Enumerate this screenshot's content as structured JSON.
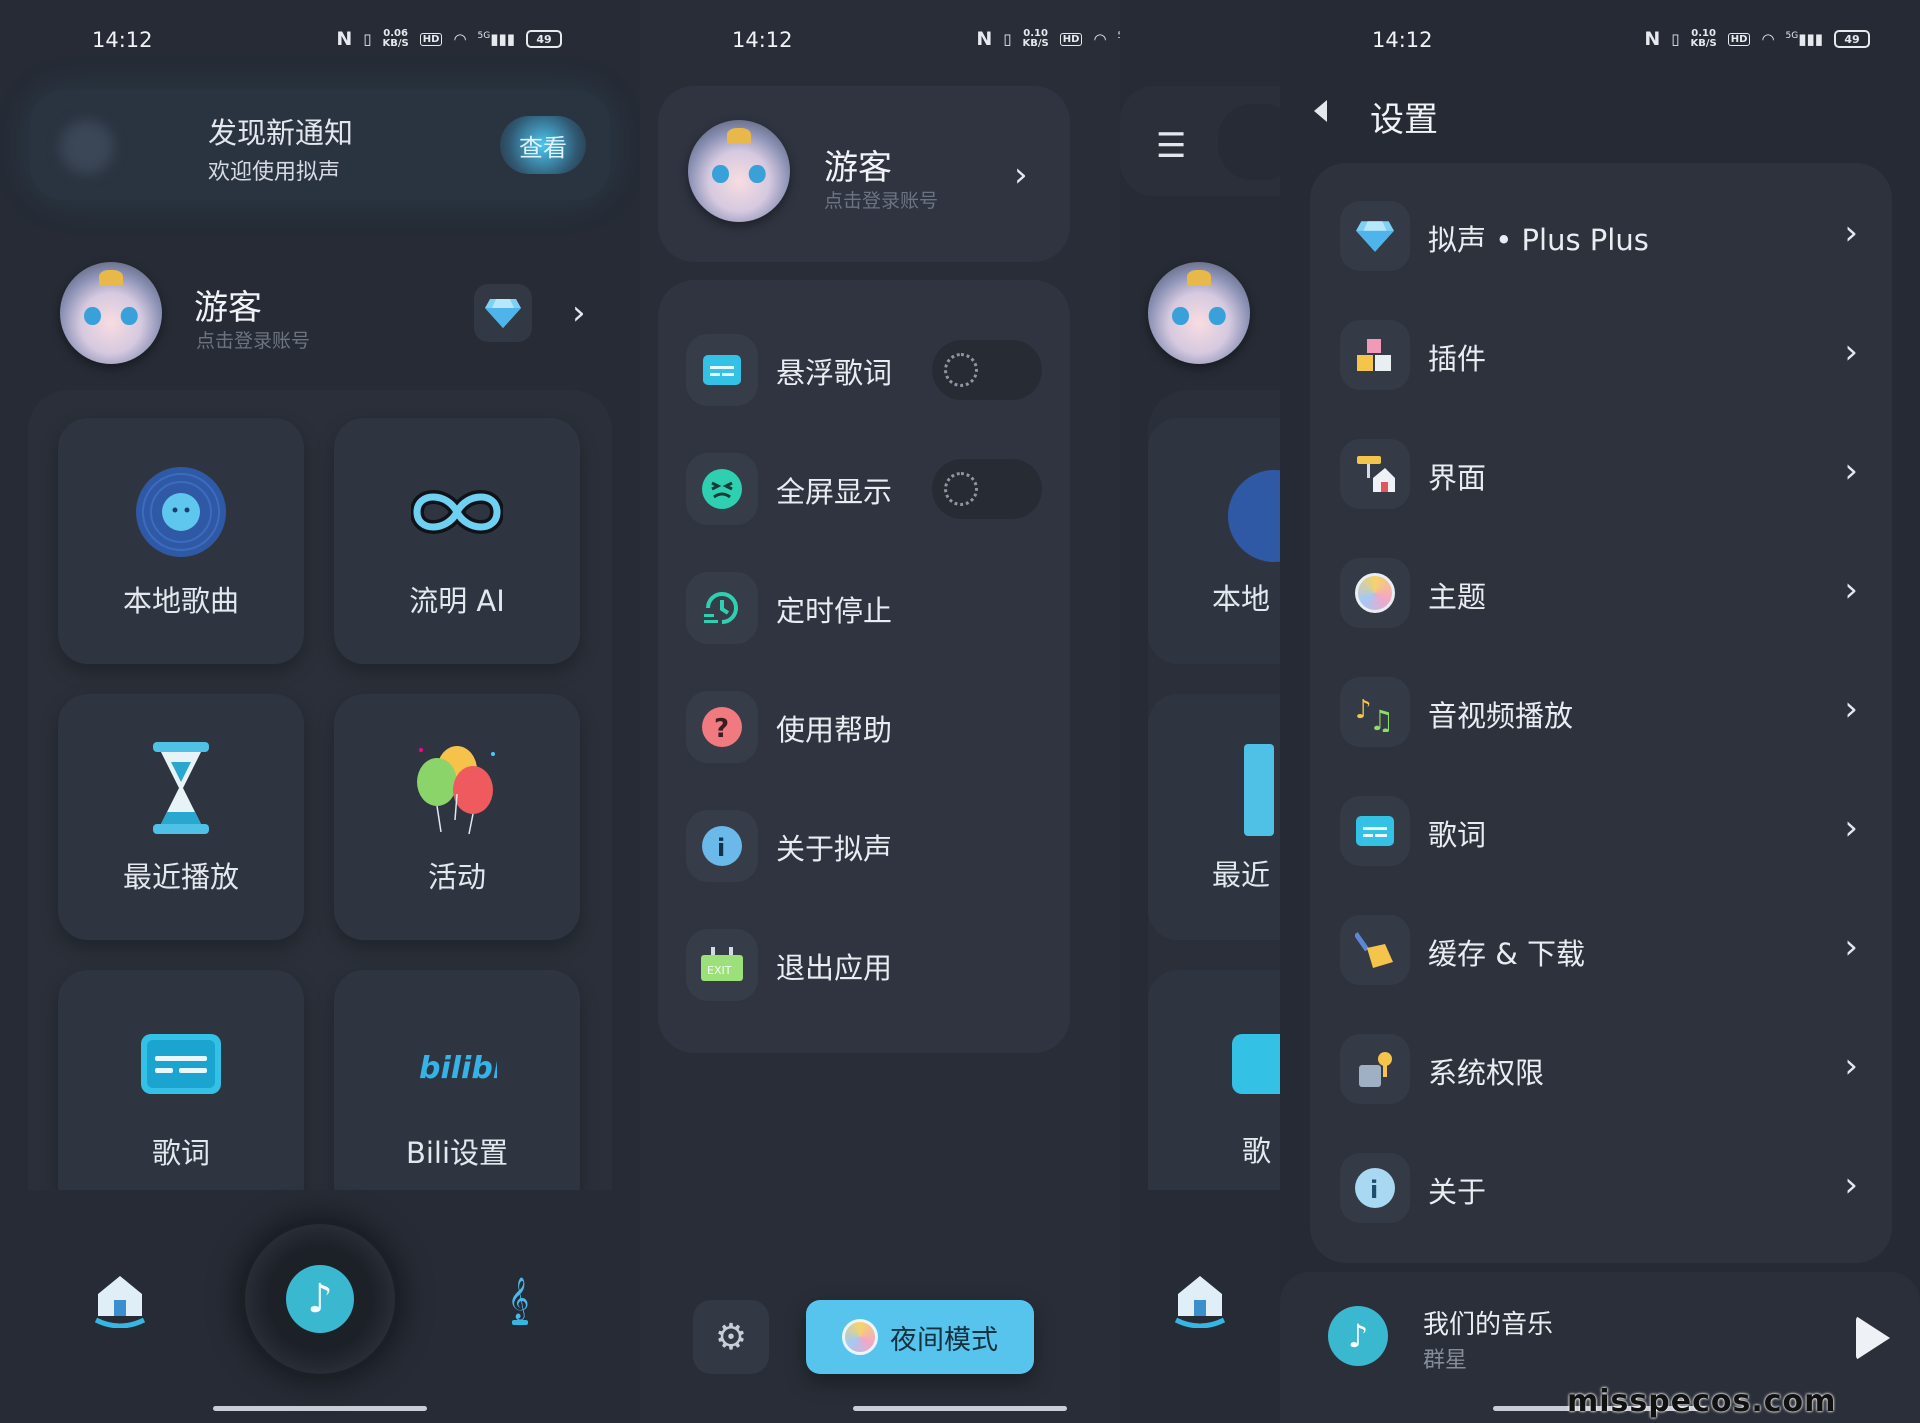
{
  "status_bar": {
    "time": "14:12",
    "speed_s1": "0.06",
    "speed_s2": "0.10",
    "speed_unit": "KB/S",
    "hd": "HD",
    "signal": "5G",
    "battery": "49",
    "nfc": "N"
  },
  "screen1": {
    "notice": {
      "title": "发现新通知",
      "subtitle": "欢迎使用拟声",
      "button": "查看"
    },
    "user": {
      "name": "游客",
      "sub": "点击登录账号",
      "badge_icon": "diamond-icon"
    },
    "tiles": [
      {
        "label": "本地歌曲",
        "icon": "vinyl-disc-icon"
      },
      {
        "label": "流明 AI",
        "icon": "infinity-icon"
      },
      {
        "label": "最近播放",
        "icon": "hourglass-icon"
      },
      {
        "label": "活动",
        "icon": "balloons-icon"
      },
      {
        "label": "歌词",
        "icon": "lyrics-icon"
      },
      {
        "label": "Bili设置",
        "icon": "bilibili-icon"
      }
    ],
    "nav": {
      "home_icon": "home-icon",
      "play_icon": "music-note-icon",
      "music_icon": "treble-clef-icon"
    }
  },
  "screen2": {
    "user": {
      "name": "游客",
      "sub": "点击登录账号"
    },
    "menu": [
      {
        "label": "悬浮歌词",
        "icon": "lyrics-icon",
        "toggle": "off"
      },
      {
        "label": "全屏显示",
        "icon": "fullscreen-icon",
        "toggle": "off"
      },
      {
        "label": "定时停止",
        "icon": "timer-icon"
      },
      {
        "label": "使用帮助",
        "icon": "help-icon"
      },
      {
        "label": "关于拟声",
        "icon": "info-icon"
      },
      {
        "label": "退出应用",
        "icon": "exit-icon"
      }
    ],
    "night_mode": "夜间模式",
    "settings_icon": "gear-icon"
  },
  "screen3": {
    "title": "设置",
    "items": [
      {
        "label": "拟声 • Plus Plus",
        "icon": "diamond-icon"
      },
      {
        "label": "插件",
        "icon": "blocks-icon"
      },
      {
        "label": "界面",
        "icon": "paint-roller-icon"
      },
      {
        "label": "主题",
        "icon": "theme-icon"
      },
      {
        "label": "音视频播放",
        "icon": "music-notes-icon"
      },
      {
        "label": "歌词",
        "icon": "lyrics-icon"
      },
      {
        "label": "缓存 & 下载",
        "icon": "broom-icon"
      },
      {
        "label": "系统权限",
        "icon": "key-icon"
      },
      {
        "label": "关于",
        "icon": "info-icon"
      }
    ],
    "player": {
      "song": "我们的音乐",
      "artist": "群星"
    },
    "peek_labels": [
      "本地",
      "最近",
      "歌"
    ]
  },
  "watermark": "misspecos.com",
  "colors": {
    "accent": "#57c4ee",
    "teal": "#3ab8d0",
    "bg": "#262b35",
    "card": "#2d323d"
  }
}
